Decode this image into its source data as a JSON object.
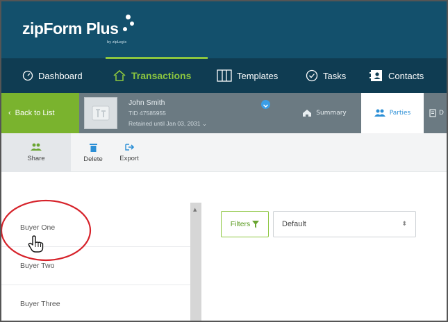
{
  "brand": {
    "logo_text": "zipForm Plus",
    "logo_sub": "by zipLogix",
    "bar_color": "#13506c"
  },
  "nav": {
    "items": [
      {
        "label": "Dashboard",
        "icon": "gauge-icon"
      },
      {
        "label": "Transactions",
        "icon": "home-icon",
        "active": true
      },
      {
        "label": "Templates",
        "icon": "templates-icon"
      },
      {
        "label": "Tasks",
        "icon": "check-circle-icon"
      },
      {
        "label": "Contacts",
        "icon": "contact-card-icon"
      }
    ],
    "accent": "#8cc63f"
  },
  "transaction": {
    "back_label": "Back to List",
    "name": "John Smith",
    "tid": "TID 47585955",
    "retained": "Retained until Jan 03, 2031",
    "tabs": [
      {
        "label": "Summary",
        "icon": "home-icon"
      },
      {
        "label": "Parties",
        "icon": "people-icon",
        "active": true
      },
      {
        "label": "D",
        "icon": "document-icon"
      }
    ]
  },
  "toolbar": {
    "share_label": "Share",
    "delete_label": "Delete",
    "export_label": "Export"
  },
  "parties": {
    "items": [
      "Buyer One",
      "Buyer Two",
      "Buyer Three"
    ]
  },
  "filters": {
    "label": "Filters",
    "selected": "Default"
  },
  "annotation": {
    "color": "#d6222a"
  }
}
